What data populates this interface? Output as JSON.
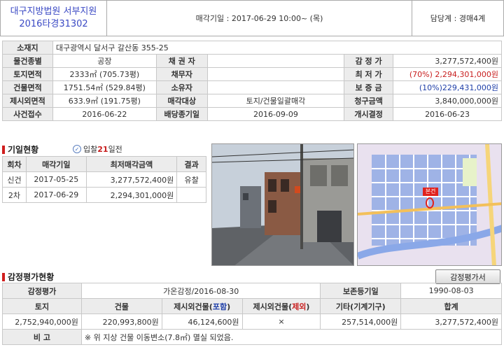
{
  "header": {
    "court_line1": "대구지방법원 서부지원",
    "court_line2": "2016타경31302",
    "auction_date": "매각기일 : 2017-06-29  10:00~ (목)",
    "team": "담당계 : 경매4계"
  },
  "info": {
    "location_label": "소재지",
    "location_value": "대구광역시 달서구 갈산동 355-25",
    "type_label": "물건종별",
    "type_value": "공장",
    "creditor_label": "채 권 자",
    "creditor_value": "",
    "appraisal_label": "감 정 가",
    "appraisal_value": "3,277,572,400원",
    "land_label": "토지면적",
    "land_value": "2333㎡ (705.73평)",
    "debtor_label": "채무자",
    "debtor_value": "",
    "min_label": "최 저 가",
    "min_value": "(70%) 2,294,301,000원",
    "bldg_label": "건물면적",
    "bldg_value": "1751.54㎡ (529.84평)",
    "owner_label": "소유자",
    "owner_value": "",
    "deposit_label": "보 증 금",
    "deposit_value": "(10%)229,431,000원",
    "excl_label": "제시외면적",
    "excl_value": "633.9㎡ (191.75평)",
    "target_label": "매각대상",
    "target_value": "토지/건물일괄매각",
    "claim_label": "청구금액",
    "claim_value": "3,840,000,000원",
    "receipt_label": "사건접수",
    "receipt_value": "2016-06-22",
    "deadline_label": "배당종기일",
    "deadline_value": "2016-09-09",
    "start_label": "개시결정",
    "start_value": "2016-06-23"
  },
  "history": {
    "title": "기일현황",
    "badge_prefix": "입찰",
    "badge_days": "21",
    "badge_suffix": "일전",
    "columns": [
      "회차",
      "매각기일",
      "최저매각금액",
      "결과"
    ],
    "rows": [
      {
        "round": "신건",
        "date": "2017-05-25",
        "price": "3,277,572,400원",
        "result": "유찰"
      },
      {
        "round": "2차",
        "date": "2017-06-29",
        "price": "2,294,301,000원",
        "result": ""
      }
    ]
  },
  "map": {
    "marker_label": "본건"
  },
  "appraisal": {
    "title": "감정평가현황",
    "button": "감정평가서",
    "row1": {
      "label": "감정평가",
      "value": "가온감정/2016-08-30",
      "pres_label": "보존등기일",
      "pres_value": "1990-08-03"
    },
    "columns": {
      "land": "토지",
      "bldg": "건물",
      "excl_inc_prefix": "제시외건물(",
      "excl_inc_word": "포함",
      "excl_inc_suffix": ")",
      "excl_exc_prefix": "제시외건물(",
      "excl_exc_word": "제외",
      "excl_exc_suffix": ")",
      "etc": "기타(기계기구)",
      "total": "합계"
    },
    "values": {
      "land": "2,752,940,000원",
      "bldg": "220,993,800원",
      "excl_inc": "46,124,600원",
      "excl_exc": "×",
      "etc": "257,514,000원",
      "total": "3,277,572,400원"
    },
    "note_label": "비 고",
    "note_value": "※ 위 지상 건물 이동변소(7.8㎡) 멸실 되었음."
  },
  "colors": {
    "court_blue": "#3a49c4",
    "accent_red": "#c81e1e",
    "price_blue": "#1f3fa8"
  }
}
